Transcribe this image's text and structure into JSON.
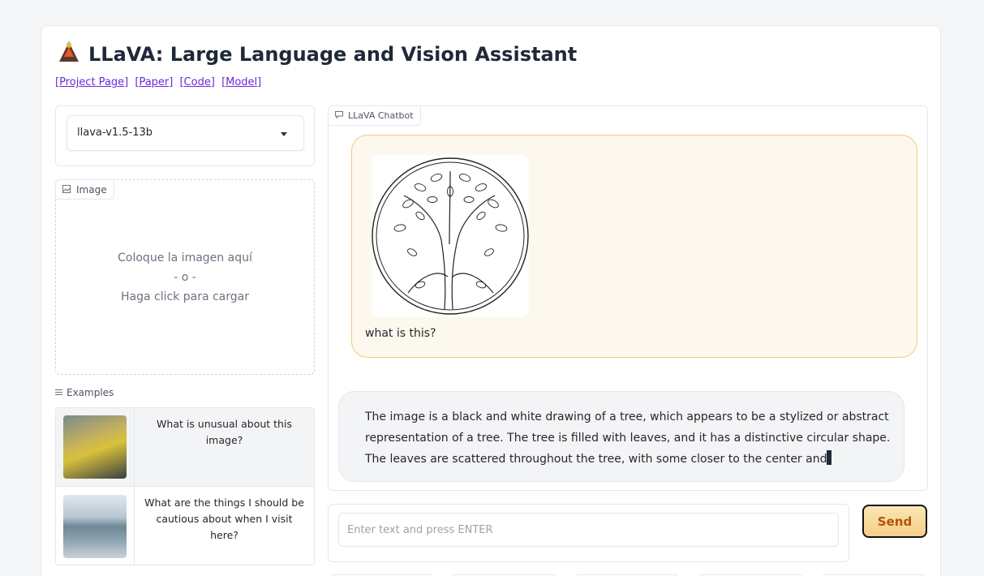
{
  "header": {
    "title": "LLaVA: Large Language and Vision Assistant",
    "links": [
      "[Project Page]",
      "[Paper]",
      "[Code]",
      "[Model]"
    ]
  },
  "model_selector": {
    "selected": "llava-v1.5-13b"
  },
  "image_upload": {
    "label": "Image",
    "line1": "Coloque la imagen aquí",
    "line2": "- o -",
    "line3": "Haga click para cargar"
  },
  "examples": {
    "label": "Examples",
    "items": [
      {
        "text": "What is unusual about this image?"
      },
      {
        "text": "What are the things I should be cautious about when I visit here?"
      }
    ]
  },
  "chatbot": {
    "label": "LLaVA Chatbot",
    "user_message": "what is this?",
    "bot_message": "The image is a black and white drawing of a tree, which appears to be a stylized or abstract representation of a tree. The tree is filled with leaves, and it has a distinctive circular shape. The leaves are scattered throughout the tree, with some closer to the center and"
  },
  "input": {
    "placeholder": "Enter text and press ENTER",
    "value": ""
  },
  "send_button": {
    "label": "Send"
  },
  "colors": {
    "accent": "#f3cf86",
    "send_text": "#b45309",
    "link": "#6d28d9",
    "user_bubble": "#fdf8ee"
  }
}
